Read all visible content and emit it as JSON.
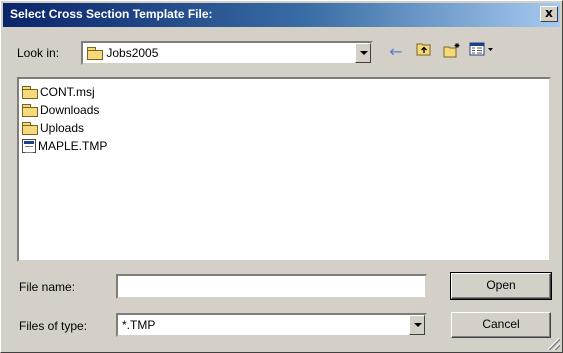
{
  "window": {
    "title": "Select Cross Section Template File:",
    "close_label": "x"
  },
  "look_in": {
    "label": "Look in:",
    "value": "Jobs2005",
    "icon": "folder-icon"
  },
  "toolbar": {
    "back_icon": "back-arrow-icon",
    "back_glyph": "←",
    "up_icon": "up-folder-icon",
    "new_folder_icon": "new-folder-icon",
    "view_menu_icon": "view-menu-icon"
  },
  "files": [
    {
      "name": "CONT.msj",
      "icon": "folder-icon"
    },
    {
      "name": "Downloads",
      "icon": "folder-icon"
    },
    {
      "name": "Uploads",
      "icon": "folder-icon"
    },
    {
      "name": "MAPLE.TMP",
      "icon": "file-icon"
    }
  ],
  "file_name": {
    "label": "File name:",
    "value": ""
  },
  "file_type": {
    "label": "Files of type:",
    "value": "*.TMP"
  },
  "buttons": {
    "open": "Open",
    "cancel": "Cancel"
  }
}
